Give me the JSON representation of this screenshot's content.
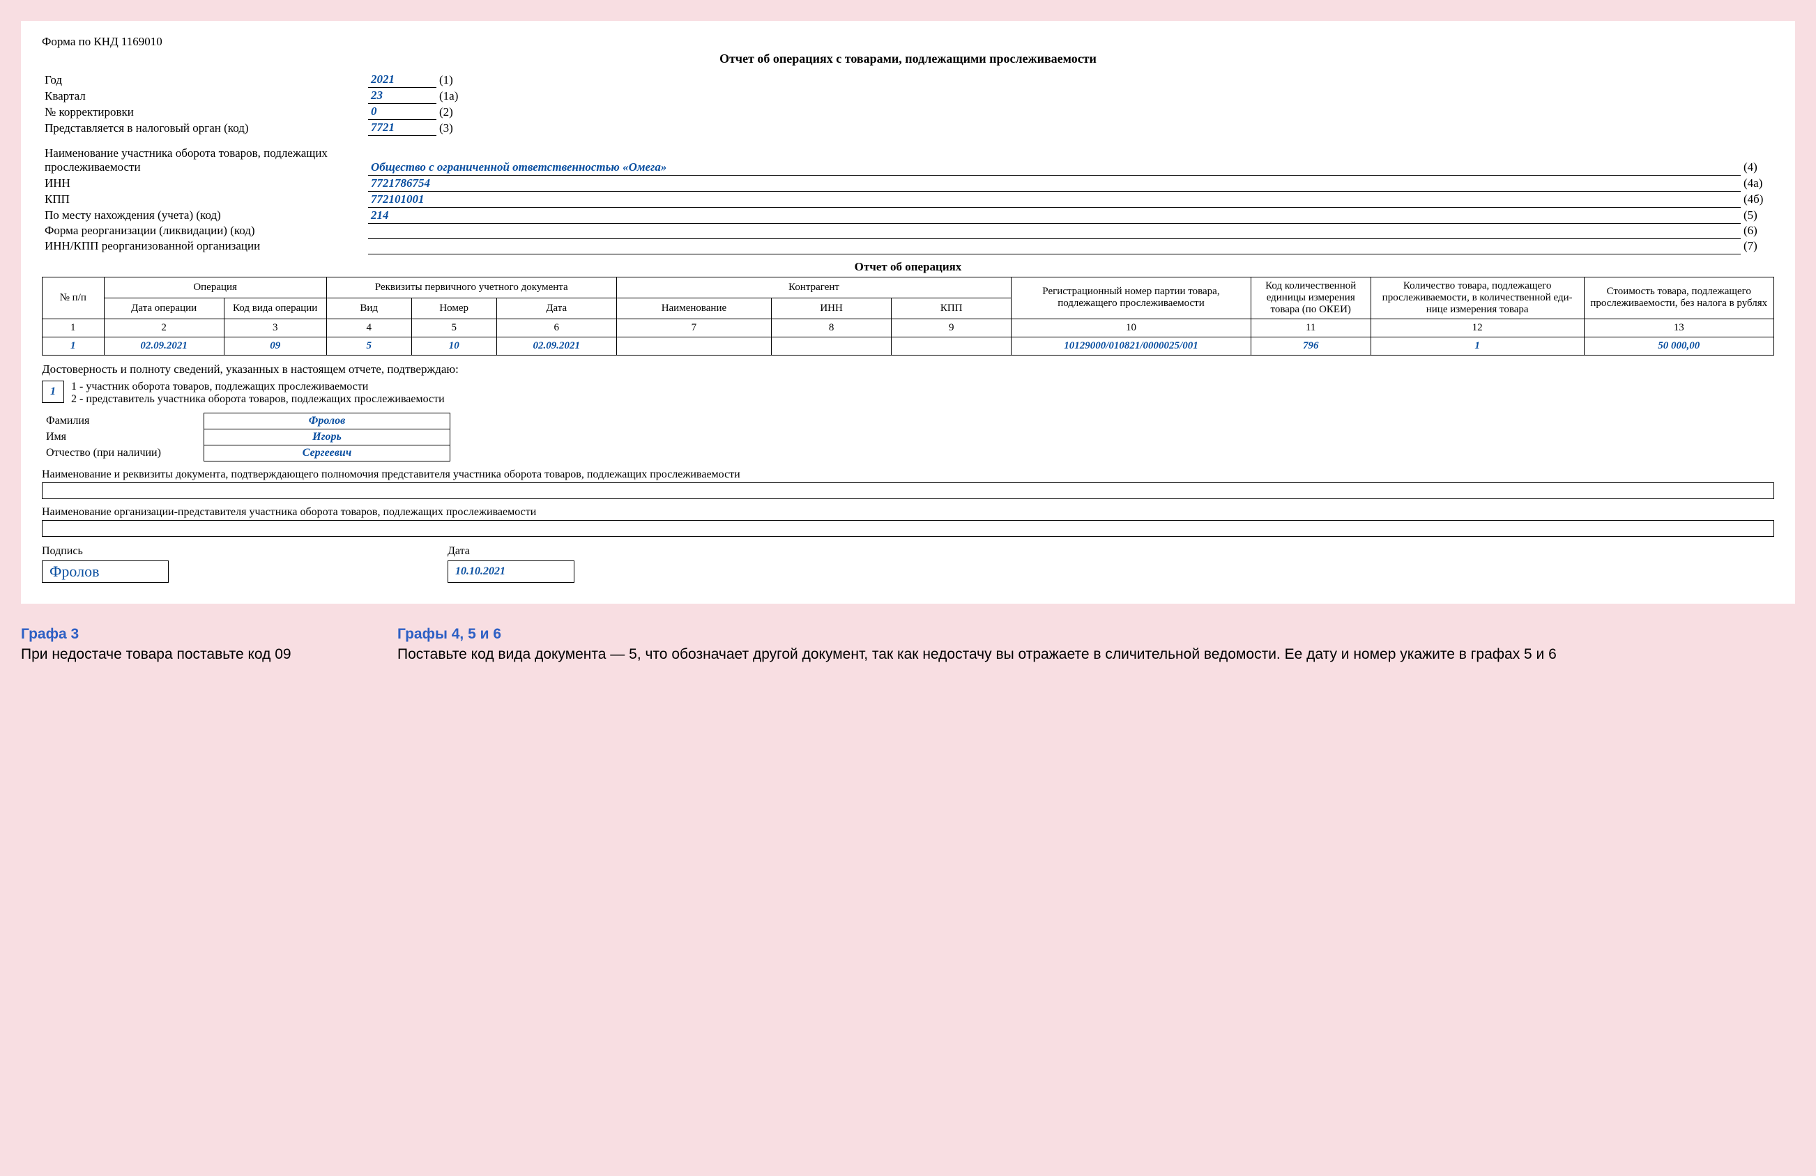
{
  "formCode": "Форма по КНД 1169010",
  "title": "Отчет об операциях с товарами, подлежащими прослеживаемости",
  "header": {
    "yearLabel": "Год",
    "year": "2021",
    "yearNum": "(1)",
    "quarterLabel": "Квартал",
    "quarter": "23",
    "quarterNum": "(1а)",
    "corrLabel": "№ корректировки",
    "corr": "0",
    "corrNum": "(2)",
    "taxLabel": "Представляется в налоговый орган (код)",
    "tax": "7721",
    "taxNum": "(3)",
    "partLabel": "Наименование участника оборота товаров, подлежащих прослеживаемости",
    "part": "Общество с ограниченной ответственностью «Омега»",
    "partNum": "(4)",
    "innLabel": "ИНН",
    "inn": "7721786754",
    "innNum": "(4а)",
    "kppLabel": "КПП",
    "kpp": "772101001",
    "kppNum": "(4б)",
    "locLabel": "По месту нахождения (учета) (код)",
    "loc": "214",
    "locNum": "(5)",
    "reorgLabel": "Форма реорганизации (ликвидации) (код)",
    "reorg": "",
    "reorgNum": "(6)",
    "reorgInnLabel": "ИНН/КПП реорганизованной организации",
    "reorgInn": "",
    "reorgInnNum": "(7)"
  },
  "opsTitle": "Отчет об операциях",
  "cols": {
    "npp": "№ п/п",
    "operation": "Операция",
    "opDate": "Дата операции",
    "opCode": "Код вида операции",
    "primary": "Реквизиты первичного учетного документа",
    "pVid": "Вид",
    "pNum": "Номер",
    "pDate": "Дата",
    "counter": "Контрагент",
    "cName": "Наименование",
    "cInn": "ИНН",
    "cKpp": "КПП",
    "reg": "Регистрационный номер партии товара, подлежащего прослеживаемости",
    "unit": "Код коли­чественной единицы измерения товара (по ОКЕИ)",
    "qty": "Количество товара, подлежащего прослеживаемости, в количественной еди­нице измерения товара",
    "cost": "Стоимость товара, подлежащего прослеживаемости, без налога в рублях"
  },
  "numRow": [
    "1",
    "2",
    "3",
    "4",
    "5",
    "6",
    "7",
    "8",
    "9",
    "10",
    "11",
    "12",
    "13"
  ],
  "dataRow": {
    "c1": "1",
    "c2": "02.09.2021",
    "c3": "09",
    "c4": "5",
    "c5": "10",
    "c6": "02.09.2021",
    "c7": "",
    "c8": "",
    "c9": "",
    "c10": "10129000/010821/0000025/001",
    "c11": "796",
    "c12": "1",
    "c13": "50 000,00"
  },
  "confirm": "Достоверность и полноту сведений, указанных в настоящем отчете, подтверждаю:",
  "roleValue": "1",
  "role1": "1 - участник оборота товаров, подлежащих прослеживаемости",
  "role2": "2 - представитель участника оборота товаров, подлежащих прослеживаемости",
  "surnameLabel": "Фамилия",
  "surname": "Фролов",
  "nameLabel": "Имя",
  "name": "Игорь",
  "patrLabel": "Отчество (при наличии)",
  "patr": "Сергеевич",
  "authDoc": "Наименование и реквизиты документа, подтверждающего полномочия представителя участника оборота товаров, подлежащих прослеживаемости",
  "orgRep": "Наименование организации-представителя участника оборота товаров, подлежащих прослеживаемости",
  "sigLabel": "Подпись",
  "sig": "Фролов",
  "dateLabel": "Дата",
  "date": "10.10.2021",
  "notes": {
    "n1h": "Графа 3",
    "n1t": "При недостаче товара поставьте код 09",
    "n2h": "Графы 4, 5 и 6",
    "n2t": "Поставьте код вида документа — 5, что обозначает другой документ, так как недостачу вы отражаете в сличительной ведомости. Ее дату и номер укажите в графах 5 и 6"
  }
}
